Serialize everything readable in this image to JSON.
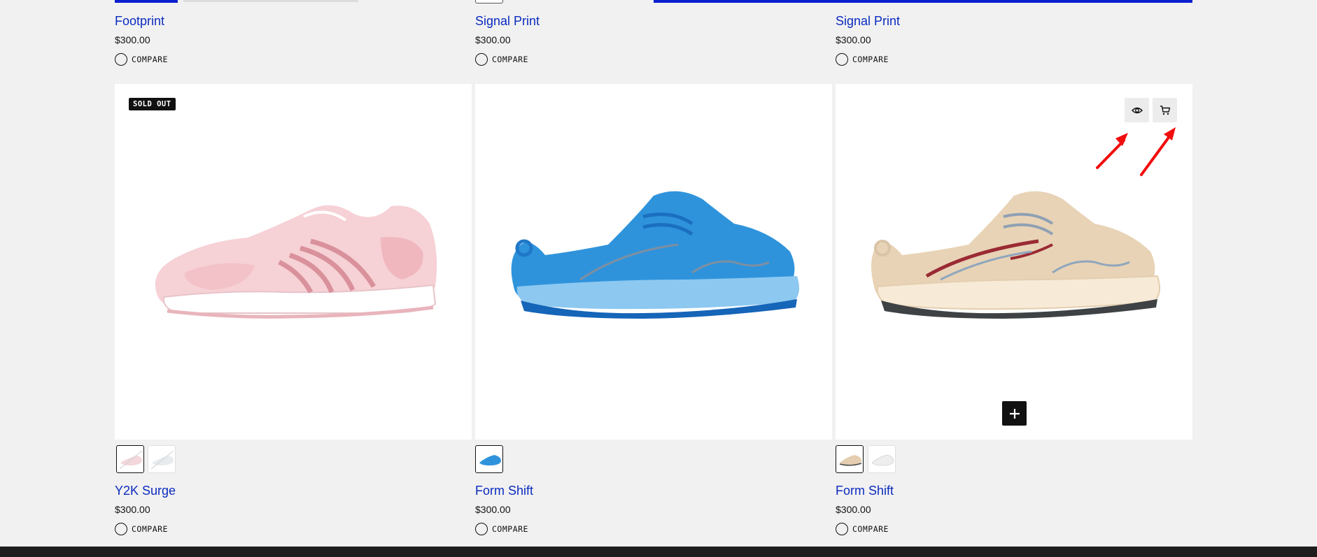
{
  "colors": {
    "background": "#f1f1f1",
    "title_link": "#0b2bbf",
    "accent_blue": "#0b1fd1",
    "badge_bg": "#111111",
    "annotation_arrow": "#f20d0d",
    "footer": "#1e1e1e"
  },
  "top_row": [
    {
      "title": "Footprint",
      "price": "$300.00",
      "compare_label": "COMPARE"
    },
    {
      "title": "Signal Print",
      "price": "$300.00",
      "compare_label": "COMPARE"
    },
    {
      "title": "Signal Print",
      "price": "$300.00",
      "compare_label": "COMPARE"
    }
  ],
  "products": [
    {
      "badge": "SOLD OUT",
      "title": "Y2K Surge",
      "price": "$300.00",
      "compare_label": "COMPARE",
      "swatches": [
        "pink-white",
        "white-grey"
      ],
      "active_swatch": 0
    },
    {
      "title": "Form Shift",
      "price": "$300.00",
      "compare_label": "COMPARE",
      "swatches": [
        "blue"
      ],
      "active_swatch": 0
    },
    {
      "title": "Form Shift",
      "price": "$300.00",
      "compare_label": "COMPARE",
      "swatches": [
        "tan",
        "white"
      ],
      "active_swatch": 0,
      "hover_actions": [
        "eye-icon",
        "cart-icon"
      ],
      "quick_add_icon": "plus-icon"
    }
  ]
}
